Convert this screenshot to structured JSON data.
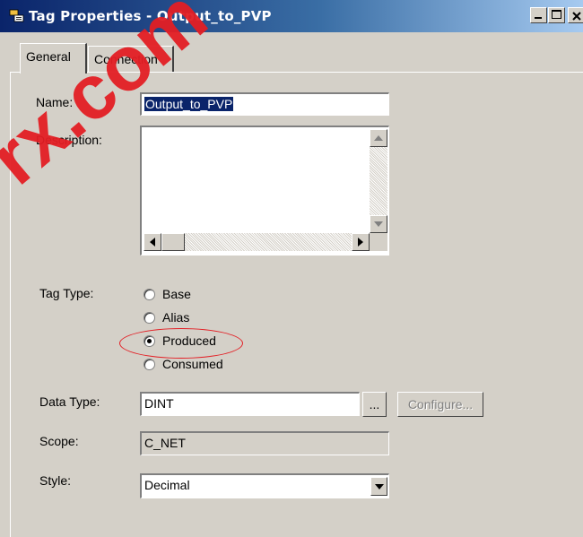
{
  "window": {
    "title": "Tag Properties - Output_to_PVP"
  },
  "tabs": [
    {
      "label": "General",
      "active": true
    },
    {
      "label": "Connection",
      "active": false
    }
  ],
  "form": {
    "name_label": "Name:",
    "name_value": "Output_to_PVP",
    "description_label": "Description:",
    "description_value": "",
    "tag_type_label": "Tag Type:",
    "tag_type_options": [
      {
        "label": "Base",
        "selected": false
      },
      {
        "label": "Alias",
        "selected": false
      },
      {
        "label": "Produced",
        "selected": true
      },
      {
        "label": "Consumed",
        "selected": false
      }
    ],
    "data_type_label": "Data Type:",
    "data_type_value": "DINT",
    "browse_button_label": "...",
    "configure_button_label": "Configure...",
    "scope_label": "Scope:",
    "scope_value": "C_NET",
    "style_label": "Style:",
    "style_value": "Decimal"
  },
  "watermark": "rx.com",
  "colors": {
    "titlebar_start": "#0a246a",
    "titlebar_end": "#a6caf0",
    "dialog_face": "#d4d0c8",
    "highlight": "#e31e24"
  },
  "icons": {
    "title": "tag-properties-icon",
    "minimize": "minimize-icon",
    "maximize": "maximize-icon",
    "close": "close-icon"
  }
}
